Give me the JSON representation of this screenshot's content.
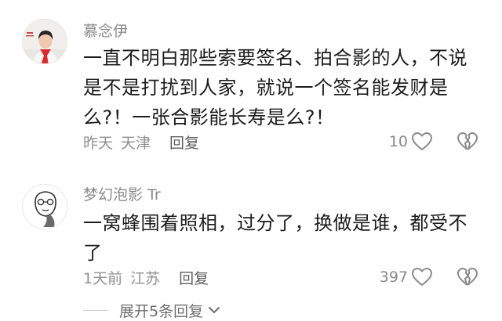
{
  "comments": [
    {
      "username": "慕念伊",
      "content": "一直不明白那些索要签名、拍合影的人，不说是不是打扰到人家，就说一个签名能发财是么?！一张合影能长寿是么?！",
      "time": "昨天",
      "location": "天津",
      "reply_label": "回复",
      "likes": "10",
      "avatar_icon": "person-photo-avatar"
    },
    {
      "username": "梦幻泡影 Tr",
      "content": "一窝蜂围着照相，过分了，换做是谁，都受不了",
      "time": "1天前",
      "location": "江苏",
      "reply_label": "回复",
      "likes": "397",
      "avatar_icon": "cartoon-sketch-avatar"
    }
  ],
  "expand_label": "展开5条回复",
  "icons": {
    "like": "heart-outline-icon",
    "dislike": "broken-heart-icon",
    "expand": "chevron-down-icon"
  },
  "colors": {
    "text": "#1c1c1c",
    "muted": "#8a8a8a",
    "accent_red": "#d92b2b"
  }
}
